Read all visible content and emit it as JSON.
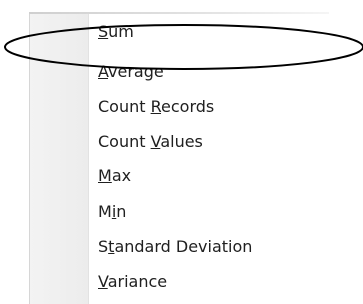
{
  "menu": {
    "items": [
      {
        "before": "",
        "access": "S",
        "after": "um"
      },
      {
        "before": "",
        "access": "A",
        "after": "verage"
      },
      {
        "before": "Count ",
        "access": "R",
        "after": "ecords"
      },
      {
        "before": "Count ",
        "access": "V",
        "after": "alues"
      },
      {
        "before": "",
        "access": "M",
        "after": "ax"
      },
      {
        "before": "M",
        "access": "i",
        "after": "n"
      },
      {
        "before": "S",
        "access": "t",
        "after": "andard Deviation"
      },
      {
        "before": "",
        "access": "V",
        "after": "ariance"
      }
    ],
    "highlighted_item": "Sum"
  },
  "annotation": {
    "type": "ellipse",
    "color": "#000000"
  }
}
